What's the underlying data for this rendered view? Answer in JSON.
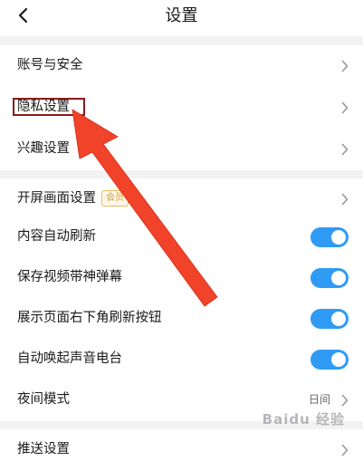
{
  "header": {
    "title": "设置",
    "back_icon": "chevron-left-icon"
  },
  "settings": {
    "account_security": "账号与安全",
    "privacy": "隐私设置",
    "interests": "兴趣设置",
    "splash_screen": "开屏画面设置",
    "splash_badge": "会员",
    "auto_refresh": "内容自动刷新",
    "auto_refresh_on": true,
    "save_video_danmaku": "保存视频带神弹幕",
    "save_video_danmaku_on": true,
    "show_refresh_button": "展示页面右下角刷新按钮",
    "show_refresh_button_on": true,
    "auto_wake_radio": "自动唤起声音电台",
    "auto_wake_radio_on": true,
    "night_mode": "夜间模式",
    "night_mode_value": "日间",
    "push_settings": "推送设置"
  },
  "watermark": "Baidu 经验",
  "colors": {
    "toggle_on": "#2f9bf4",
    "annotation_arrow": "#f0432a",
    "highlight_box": "#8b1a1a",
    "group_gap": "#f2f2f5"
  }
}
